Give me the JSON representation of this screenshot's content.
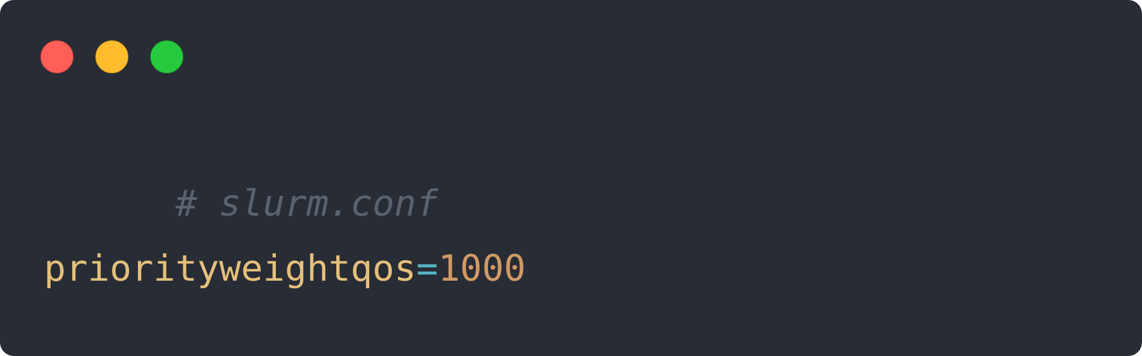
{
  "window": {
    "controls": [
      {
        "name": "close",
        "color": "#ff5f56"
      },
      {
        "name": "minimize",
        "color": "#ffbd2e"
      },
      {
        "name": "maximize",
        "color": "#27c93f"
      }
    ]
  },
  "code": {
    "comment": "# slurm.conf",
    "setting": {
      "key": "priorityweightqos",
      "operator": "=",
      "value": "1000"
    }
  },
  "colors": {
    "background": "#282c35",
    "comment": "#5c6370",
    "key": "#e5c07b",
    "operator": "#56b6c2",
    "number": "#d19a66"
  }
}
